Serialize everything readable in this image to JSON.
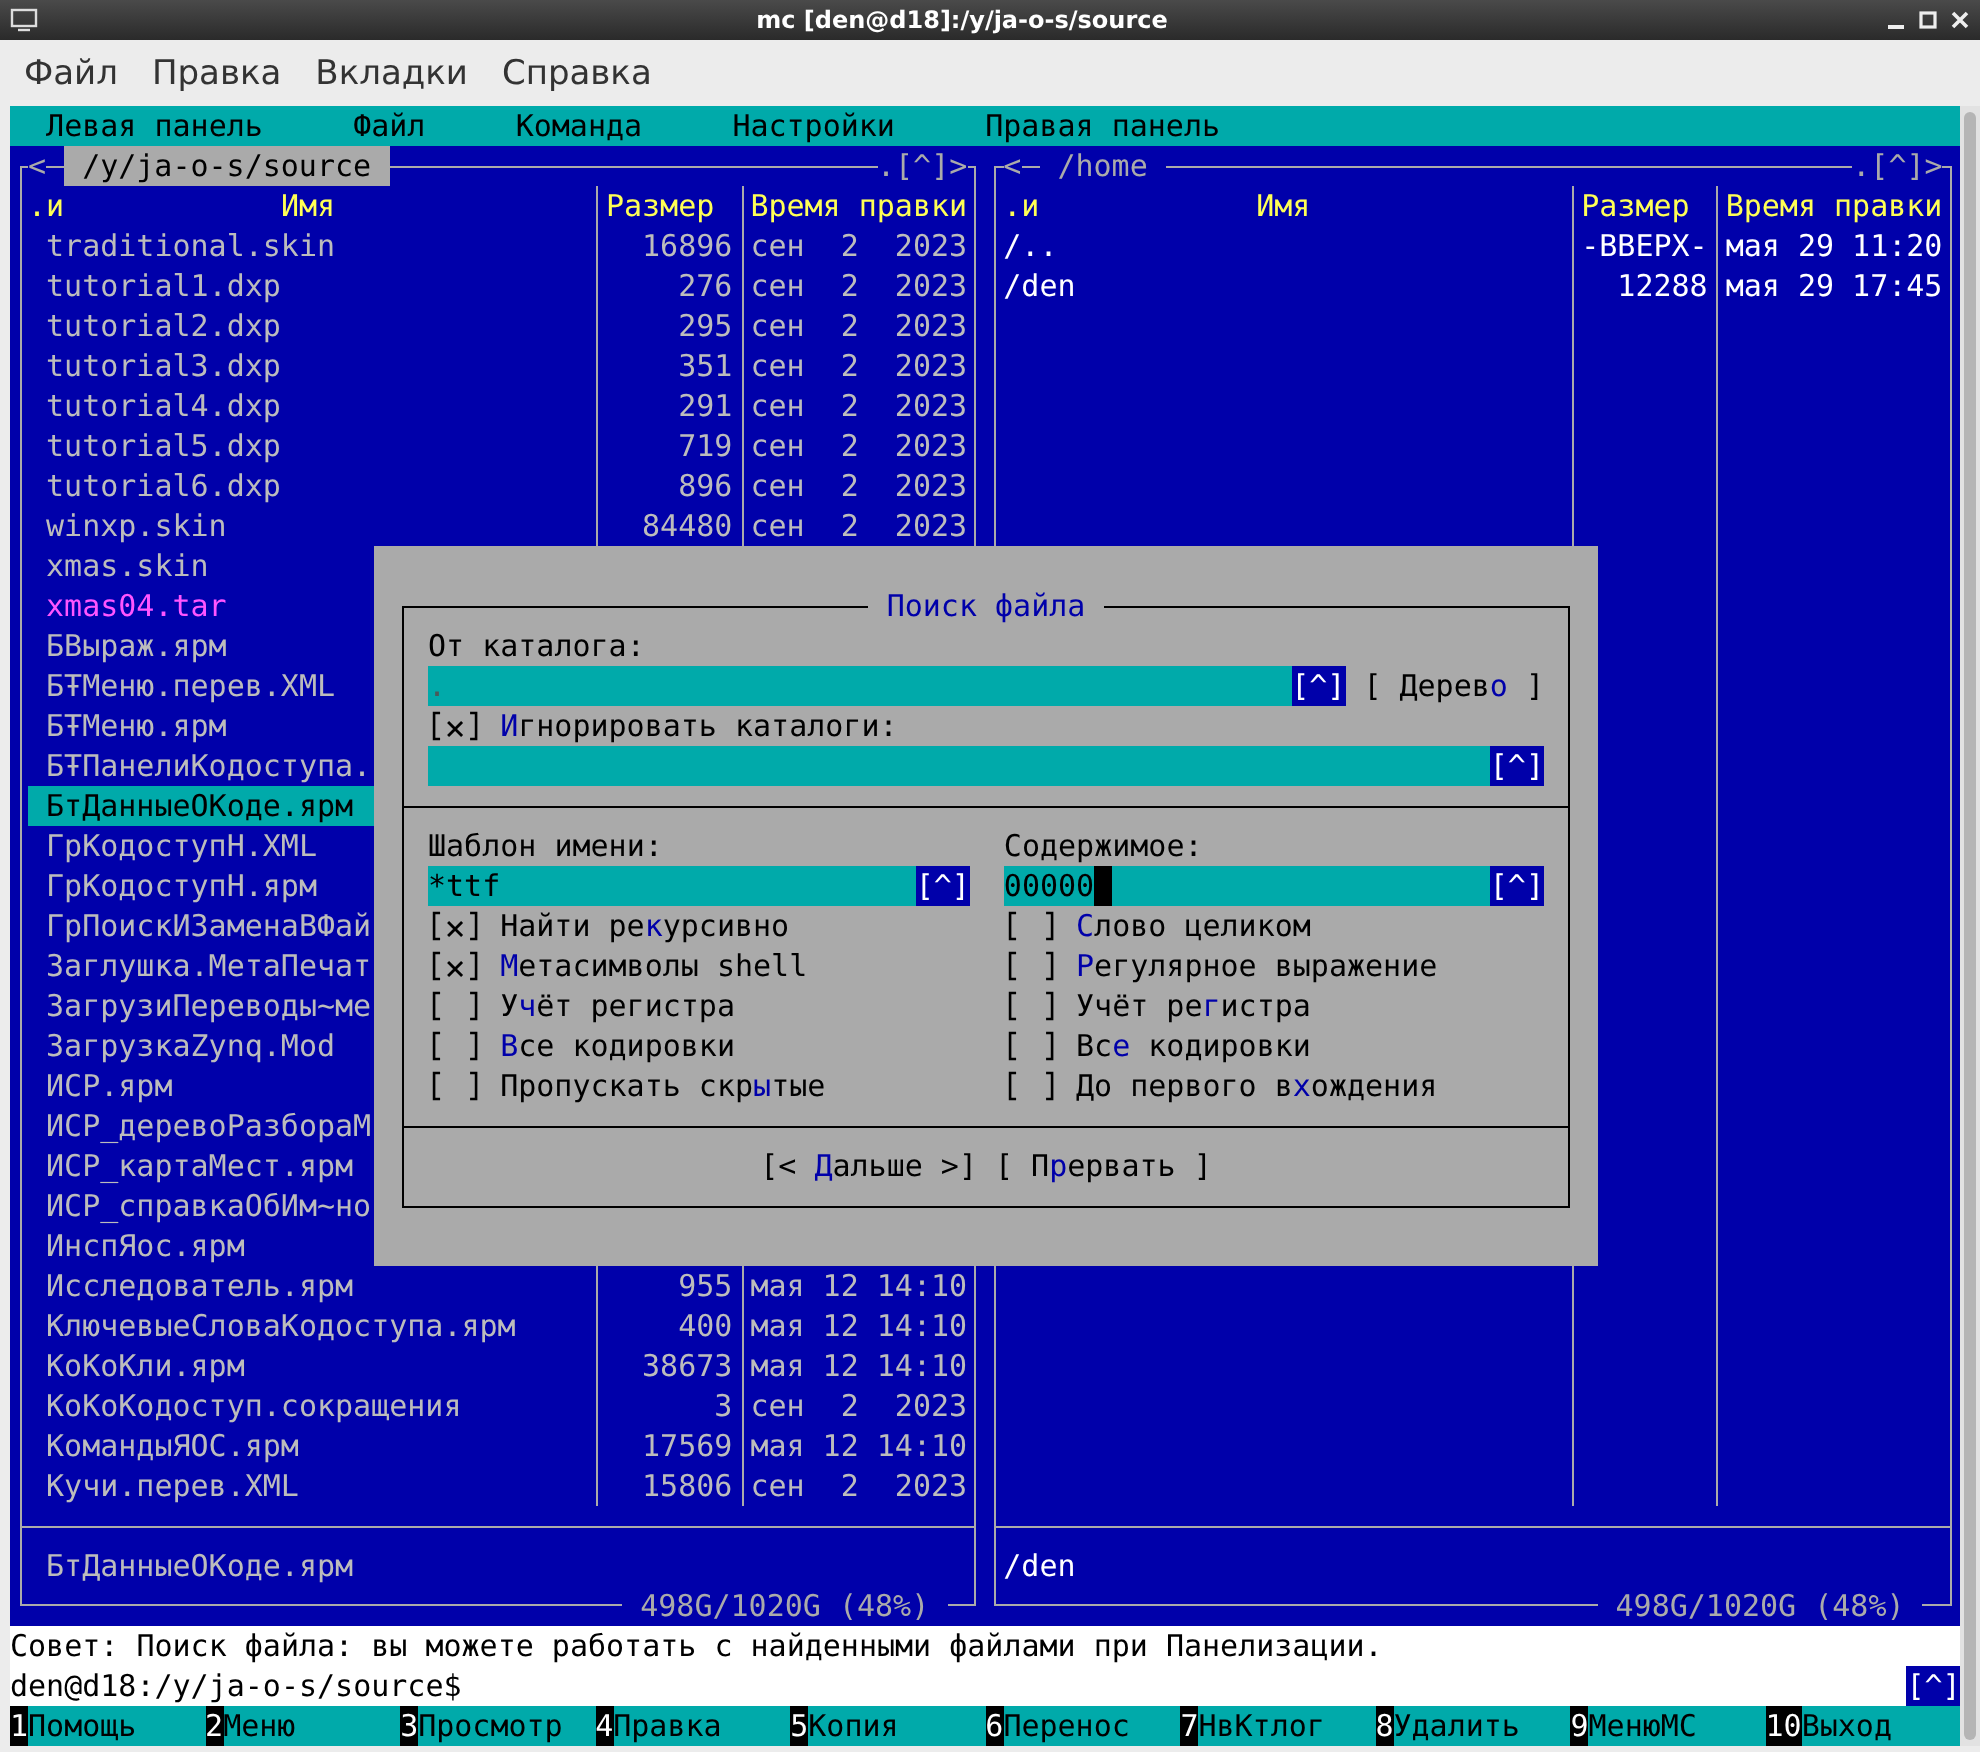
{
  "window": {
    "title": "mc [den@d18]:/y/ja-o-s/source"
  },
  "menu_bar": [
    "Файл",
    "Правка",
    "Вкладки",
    "Справка"
  ],
  "mc_menu": [
    "Левая панель",
    "Файл",
    "Команда",
    "Настройки",
    "Правая панель"
  ],
  "panels": [
    {
      "active": true,
      "history_left": "<",
      "path": "/y/ja-o-s/source",
      "history_right": ".[^]>",
      "columns": [
        ".и",
        "Имя",
        "Размер",
        "Время правки"
      ],
      "files": [
        {
          "name": "traditional.skin",
          "size": "16896",
          "date": "сен  2  2023",
          "kind": "file",
          "selected": false
        },
        {
          "name": "tutorial1.dxp",
          "size": "276",
          "date": "сен  2  2023",
          "kind": "file",
          "selected": false
        },
        {
          "name": "tutorial2.dxp",
          "size": "295",
          "date": "сен  2  2023",
          "kind": "file",
          "selected": false
        },
        {
          "name": "tutorial3.dxp",
          "size": "351",
          "date": "сен  2  2023",
          "kind": "file",
          "selected": false
        },
        {
          "name": "tutorial4.dxp",
          "size": "291",
          "date": "сен  2  2023",
          "kind": "file",
          "selected": false
        },
        {
          "name": "tutorial5.dxp",
          "size": "719",
          "date": "сен  2  2023",
          "kind": "file",
          "selected": false
        },
        {
          "name": "tutorial6.dxp",
          "size": "896",
          "date": "сен  2  2023",
          "kind": "file",
          "selected": false
        },
        {
          "name": "winxp.skin",
          "size": "84480",
          "date": "сен  2  2023",
          "kind": "file",
          "selected": false
        },
        {
          "name": "xmas.skin",
          "kind": "file",
          "selected": false
        },
        {
          "name": "xmas04.tar",
          "kind": "archive",
          "selected": false
        },
        {
          "name": "БВыраж.ярм",
          "kind": "file",
          "selected": false
        },
        {
          "name": "БŦМеню.перев.XML",
          "kind": "file",
          "selected": false
        },
        {
          "name": "БŦМеню.ярм",
          "kind": "file",
          "selected": false
        },
        {
          "name": "БŦПанелиКодоступа.",
          "kind": "file",
          "selected": false
        },
        {
          "name": "БтДанныеОКоде.ярм",
          "kind": "file",
          "selected": true
        },
        {
          "name": "ГрКодоступН.XML",
          "kind": "file",
          "selected": false
        },
        {
          "name": "ГрКодоступН.ярм",
          "kind": "file",
          "selected": false
        },
        {
          "name": "ГрПоискИЗаменаВФай",
          "kind": "file",
          "selected": false
        },
        {
          "name": "Заглушка.МетаПечат",
          "kind": "file",
          "selected": false
        },
        {
          "name": "ЗагрузиПереводы~ме",
          "kind": "file",
          "selected": false
        },
        {
          "name": "ЗагрузкаZynq.Mod",
          "kind": "file",
          "selected": false
        },
        {
          "name": "ИСР.ярм",
          "kind": "file",
          "selected": false
        },
        {
          "name": "ИСР_деревоРазбораМ",
          "kind": "file",
          "selected": false
        },
        {
          "name": "ИСР_картаМест.ярм",
          "kind": "file",
          "selected": false
        },
        {
          "name": "ИСР_справкаОбИм~но",
          "kind": "file",
          "selected": false
        },
        {
          "name": "ИнспЯос.ярм",
          "kind": "file",
          "selected": false
        },
        {
          "name": "Исследователь.ярм",
          "size": "955",
          "date": "мая 12 14:10",
          "kind": "file",
          "selected": false
        },
        {
          "name": "КлючевыеСловаКодоступа.ярм",
          "size": "400",
          "date": "мая 12 14:10",
          "kind": "file",
          "selected": false
        },
        {
          "name": "КоКоКли.ярм",
          "size": "38673",
          "date": "мая 12 14:10",
          "kind": "file",
          "selected": false
        },
        {
          "name": "КоКоКодоступ.сокращения",
          "size": "3",
          "date": "сен  2  2023",
          "kind": "file",
          "selected": false
        },
        {
          "name": "КомандыЯОС.ярм",
          "size": "17569",
          "date": "мая 12 14:10",
          "kind": "file",
          "selected": false
        },
        {
          "name": "Кучи.перев.XML",
          "size": "15806",
          "date": "сен  2  2023",
          "kind": "file",
          "selected": false
        }
      ],
      "mini_status": {
        "text": "БтДанныеОКоде.ярм",
        "kind": "file"
      },
      "disk_info": "498G/1020G (48%)"
    },
    {
      "active": false,
      "history_left": "<",
      "path": "/home",
      "history_right": ".[^]>",
      "columns": [
        ".и",
        "Имя",
        "Размер",
        "Время правки"
      ],
      "files": [
        {
          "name": "/..",
          "size": "-ВВЕРХ-",
          "date": "мая 29 11:20",
          "kind": "dir",
          "selected": false
        },
        {
          "name": "/den",
          "size": "12288",
          "date": "мая 29 17:45",
          "kind": "dir",
          "selected": false
        }
      ],
      "mini_status": {
        "text": "/den",
        "kind": "dir"
      },
      "disk_info": "498G/1020G (48%)"
    }
  ],
  "dialog": {
    "title": "Поиск файла",
    "start_dir_label": "От каталога:",
    "start_dir": {
      "value": ".",
      "history": "[^]",
      "focused": false
    },
    "tree_button": [
      {
        "text": "[ Дерев",
        "hotkey": false
      },
      {
        "text": "о",
        "hotkey": true
      },
      {
        "text": " ]",
        "hotkey": false
      }
    ],
    "ignore_dirs": {
      "checked": true,
      "label": [
        {
          "text": "И",
          "hotkey": true
        },
        {
          "text": "гнорировать каталоги:",
          "hotkey": false
        }
      ]
    },
    "ignore_field": {
      "history": "[^]",
      "focused": false
    },
    "name_label": "Шаблон имени:",
    "name_field": {
      "value": "*ttf",
      "history": "[^]",
      "focused": false
    },
    "content_label": "Содержимое:",
    "content_field": {
      "value": "00000",
      "history": "[^]",
      "focused": true
    },
    "left_options": [
      {
        "checked": true,
        "label": [
          {
            "text": "Найти ре",
            "hotkey": false
          },
          {
            "text": "к",
            "hotkey": true
          },
          {
            "text": "урсивно",
            "hotkey": false
          }
        ]
      },
      {
        "checked": true,
        "label": [
          {
            "text": "М",
            "hotkey": true
          },
          {
            "text": "етасимволы shell",
            "hotkey": false
          }
        ]
      },
      {
        "checked": false,
        "label": [
          {
            "text": "У",
            "hotkey": false
          },
          {
            "text": "ч",
            "hotkey": true
          },
          {
            "text": "ёт регистра",
            "hotkey": false
          }
        ]
      },
      {
        "checked": false,
        "label": [
          {
            "text": "В",
            "hotkey": true
          },
          {
            "text": "се кодировки",
            "hotkey": false
          }
        ]
      },
      {
        "checked": false,
        "label": [
          {
            "text": "Пропускать скр",
            "hotkey": false
          },
          {
            "text": "ы",
            "hotkey": true
          },
          {
            "text": "тые",
            "hotkey": false
          }
        ]
      }
    ],
    "right_options": [
      {
        "checked": false,
        "label": [
          {
            "text": "С",
            "hotkey": true
          },
          {
            "text": "лово целиком",
            "hotkey": false
          }
        ]
      },
      {
        "checked": false,
        "label": [
          {
            "text": "Р",
            "hotkey": true
          },
          {
            "text": "егулярное выражение",
            "hotkey": false
          }
        ]
      },
      {
        "checked": false,
        "label": [
          {
            "text": "Учёт ре",
            "hotkey": false
          },
          {
            "text": "г",
            "hotkey": true
          },
          {
            "text": "истра",
            "hotkey": false
          }
        ]
      },
      {
        "checked": false,
        "label": [
          {
            "text": "Вс",
            "hotkey": false
          },
          {
            "text": "е",
            "hotkey": true
          },
          {
            "text": " кодировки",
            "hotkey": false
          }
        ]
      },
      {
        "checked": false,
        "label": [
          {
            "text": "До первого в",
            "hotkey": false
          },
          {
            "text": "х",
            "hotkey": true
          },
          {
            "text": "ождения",
            "hotkey": false
          }
        ]
      }
    ],
    "buttons": [
      {
        "label": [
          {
            "text": "[< ",
            "hotkey": false
          },
          {
            "text": "Д",
            "hotkey": true
          },
          {
            "text": "альше >]",
            "hotkey": false
          }
        ]
      },
      {
        "label": [
          {
            "text": "[ П",
            "hotkey": false
          },
          {
            "text": "р",
            "hotkey": true
          },
          {
            "text": "ервать ]",
            "hotkey": false
          }
        ]
      }
    ]
  },
  "hint": "Совет: Поиск файла: вы можете работать с найденными файлами при Панелизации.",
  "prompt": "den@d18:/y/ja-o-s/source$",
  "prompt_button": "[^]",
  "function_keys": [
    {
      "key": "1",
      "label": "Помощь"
    },
    {
      "key": "2",
      "label": "Меню"
    },
    {
      "key": "3",
      "label": "Просмотр"
    },
    {
      "key": "4",
      "label": "Правка"
    },
    {
      "key": "5",
      "label": "Копия"
    },
    {
      "key": "6",
      "label": "Перенос"
    },
    {
      "key": "7",
      "label": "НвКтлог"
    },
    {
      "key": "8",
      "label": "Удалить"
    },
    {
      "key": "9",
      "label": "МенюМС"
    },
    {
      "key": "10",
      "label": "Выход"
    }
  ]
}
